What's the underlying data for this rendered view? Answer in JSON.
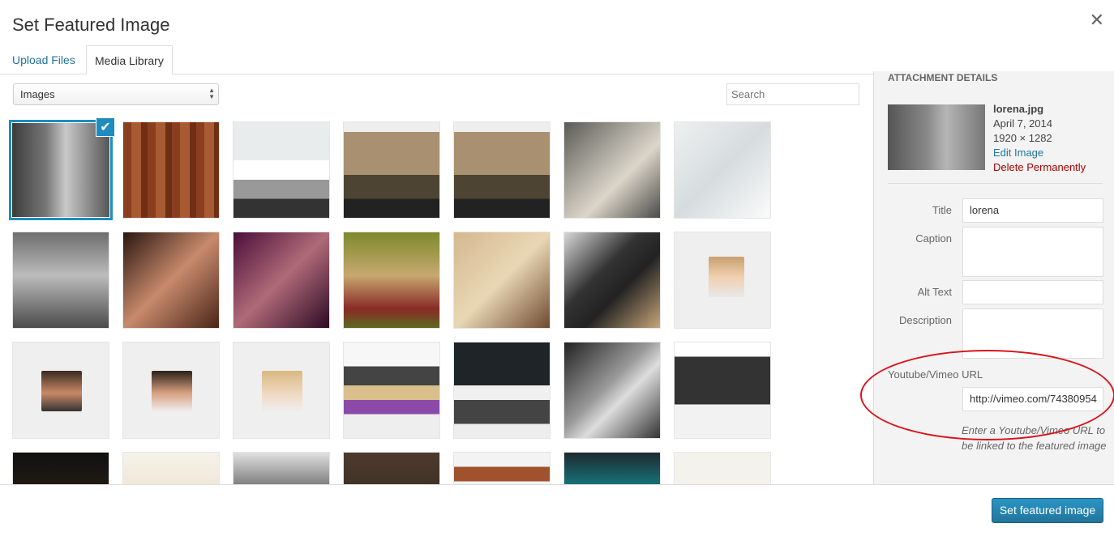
{
  "modal": {
    "title": "Set Featured Image",
    "close_icon": "close-icon"
  },
  "tabs": [
    {
      "label": "Upload Files"
    },
    {
      "label": "Media Library"
    }
  ],
  "toolbar": {
    "filter_value": "Images",
    "search_placeholder": "Search"
  },
  "grid": {
    "selected_index": 0,
    "items": [
      "lorena",
      "wood",
      "portfolio-site",
      "street-site",
      "street-site-2",
      "women-papers",
      "phone-book",
      "beach-woman",
      "woman-portrait",
      "woman-purple",
      "woman-grass",
      "woman-lying",
      "laptop-coffee",
      "avatar-woman",
      "avatar-man-1",
      "avatar-man-2",
      "avatar-woman-2",
      "portfolio-grid",
      "portfolio-dark",
      "fashion-site",
      "devices",
      "tablet-dark",
      "floating-objects",
      "clothes",
      "leather",
      "wood-bar",
      "mintosh",
      "blank"
    ]
  },
  "sidebar": {
    "heading": "ATTACHMENT DETAILS",
    "filename": "lorena.jpg",
    "date": "April 7, 2014",
    "dimensions": "1920 × 1282",
    "edit_link": "Edit Image",
    "delete_link": "Delete Permanently",
    "fields": {
      "title_label": "Title",
      "title_value": "lorena",
      "caption_label": "Caption",
      "caption_value": "",
      "alt_label": "Alt Text",
      "alt_value": "",
      "description_label": "Description",
      "description_value": ""
    },
    "url_label": "Youtube/Vimeo URL",
    "url_value": "http://vimeo.com/74380954",
    "url_help": "Enter a Youtube/Vimeo URL to be linked to the featured image"
  },
  "footer": {
    "button_label": "Set featured image"
  },
  "colors": {
    "accent": "#1e8cbe",
    "link": "#21759b",
    "delete": "#aa0000",
    "annotation": "#d9131a"
  }
}
